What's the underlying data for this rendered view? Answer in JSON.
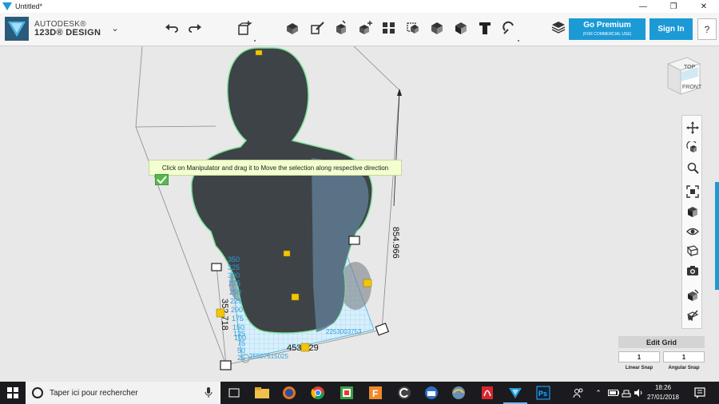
{
  "window": {
    "title": "Untitled*",
    "minimize": "—",
    "maximize": "❐",
    "close": "✕"
  },
  "brand": {
    "line1": "AUTODESK®",
    "line2": "123D® DESIGN"
  },
  "toolbar": {
    "tools": [
      "undo-icon",
      "redo-icon",
      "primitives-icon",
      "sketch-icon",
      "construct-icon",
      "modify-icon",
      "pattern-icon",
      "grouping-icon",
      "combine-icon",
      "measure-icon",
      "text-icon",
      "snap-icon",
      "material-icon"
    ],
    "premium_label": "Go Premium",
    "premium_sub": "(FOR COMMERCIAL USE)",
    "signin_label": "Sign In",
    "help_label": "?"
  },
  "viewport": {
    "tooltip": "Click on Manipulator and drag it to Move the selection along respective direction",
    "dim_height": "854.966",
    "dim_depth": "352.718",
    "dim_width": "453.429",
    "ruler_labels": [
      "350",
      "325",
      "300",
      "275",
      "250",
      "225",
      "200",
      "175",
      "150",
      "125",
      "100",
      "75",
      "50",
      "25"
    ],
    "ruler_bottom": "25507515025",
    "ruler_right": "2253003753",
    "accent_color": "#1c9ad6",
    "grid_color": "#6ec3ee",
    "model_color": "#3e4348",
    "handle_color": "#f2c700"
  },
  "viewcube": {
    "top": "TOP",
    "front": "FRONT"
  },
  "right_panel": {
    "tools": [
      "pan-icon",
      "orbit-icon",
      "zoom-icon",
      "fit-icon",
      "views-icon",
      "visibility-icon",
      "materials-display-icon",
      "screenshot-icon",
      "grid-icon",
      "settings-icon"
    ]
  },
  "edit_grid": {
    "title": "Edit Grid",
    "linear_snap_value": "1",
    "angular_snap_value": "1",
    "linear_snap_label": "Linear Snap",
    "angular_snap_label": "Angular Snap"
  },
  "taskbar": {
    "search_placeholder": "Taper ici pour rechercher",
    "time": "18:26",
    "date": "27/01/2018"
  }
}
